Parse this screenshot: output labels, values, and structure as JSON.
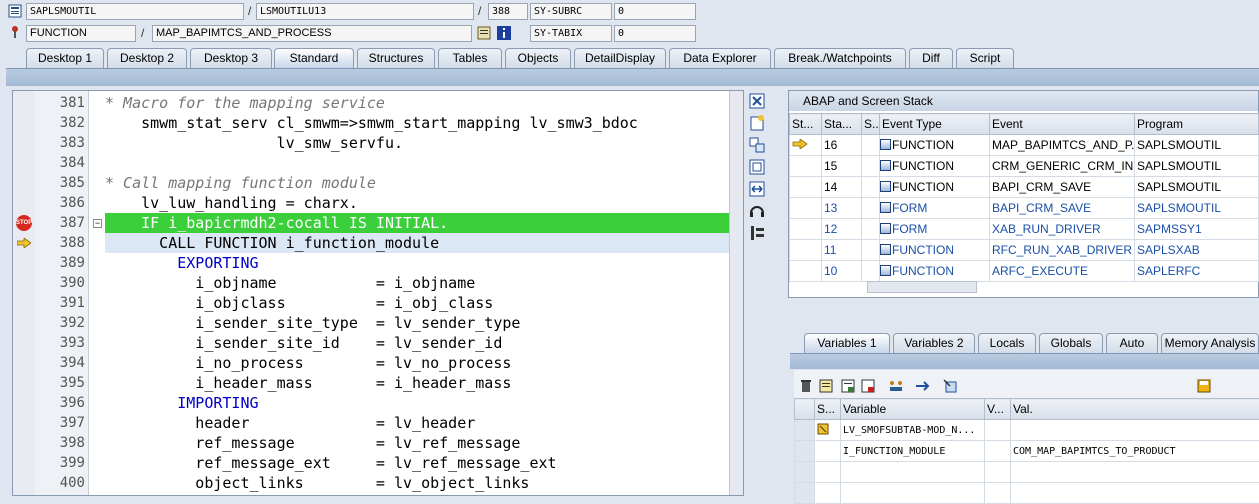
{
  "header": {
    "row1": {
      "program": "SAPLSMOUTIL",
      "include": "LSMOUTILU13",
      "line": "388",
      "sy_label": "SY-SUBRC",
      "sy_value": "0"
    },
    "row2": {
      "type": "FUNCTION",
      "name": "MAP_BAPIMTCS_AND_PROCESS",
      "sy_label": "SY-TABIX",
      "sy_value": "0"
    },
    "sep": "/"
  },
  "tabs": [
    "Desktop 1",
    "Desktop 2",
    "Desktop 3",
    "Standard",
    "Structures",
    "Tables",
    "Objects",
    "DetailDisplay",
    "Data Explorer",
    "Break./Watchpoints",
    "Diff",
    "Script"
  ],
  "active_tab": "Standard",
  "code_lines": [
    {
      "n": "381",
      "text": "* Macro for the mapping service"
    },
    {
      "n": "382",
      "text": "    smwm_stat_serv cl_smwm=>smwm_start_mapping lv_smw3_bdoc"
    },
    {
      "n": "383",
      "text": "                   lv_smw_servfu."
    },
    {
      "n": "384",
      "text": ""
    },
    {
      "n": "385",
      "text": "* Call mapping function module"
    },
    {
      "n": "386",
      "text": "    lv_luw_handling = charx."
    },
    {
      "n": "387",
      "text": "    IF i_bapicrmdh2-cocall IS INITIAL."
    },
    {
      "n": "388",
      "text": "      CALL FUNCTION i_function_module"
    },
    {
      "n": "389",
      "text": "        EXPORTING"
    },
    {
      "n": "390",
      "text": "          i_objname           = i_objname"
    },
    {
      "n": "391",
      "text": "          i_objclass          = i_obj_class"
    },
    {
      "n": "392",
      "text": "          i_sender_site_type  = lv_sender_type"
    },
    {
      "n": "393",
      "text": "          i_sender_site_id    = lv_sender_id"
    },
    {
      "n": "394",
      "text": "          i_no_process        = lv_no_process"
    },
    {
      "n": "395",
      "text": "          i_header_mass       = i_header_mass"
    },
    {
      "n": "396",
      "text": "        IMPORTING"
    },
    {
      "n": "397",
      "text": "          header              = lv_header"
    },
    {
      "n": "398",
      "text": "          ref_message         = lv_ref_message"
    },
    {
      "n": "399",
      "text": "          ref_message_ext     = lv_ref_message_ext"
    },
    {
      "n": "400",
      "text": "          object_links        = lv_object_links"
    }
  ],
  "stop_label": "STOP",
  "stack": {
    "title": "ABAP and Screen Stack",
    "headers": [
      "St...",
      "Sta...",
      "S...",
      "Event Type",
      "Event",
      "Program"
    ],
    "rows": [
      {
        "level": "16",
        "type": "FUNCTION",
        "event": "MAP_BAPIMTCS_AND_P...",
        "program": "SAPLSMOUTIL"
      },
      {
        "level": "15",
        "type": "FUNCTION",
        "event": "CRM_GENERIC_CRM_IN",
        "program": "SAPLSMOUTIL"
      },
      {
        "level": "14",
        "type": "FUNCTION",
        "event": "BAPI_CRM_SAVE",
        "program": "SAPLSMOUTIL"
      },
      {
        "level": "13",
        "type": "FORM",
        "event": "BAPI_CRM_SAVE",
        "program": "SAPLSMOUTIL"
      },
      {
        "level": "12",
        "type": "FORM",
        "event": "XAB_RUN_DRIVER",
        "program": "SAPMSSY1"
      },
      {
        "level": "11",
        "type": "FUNCTION",
        "event": "RFC_RUN_XAB_DRIVER",
        "program": "SAPLSXAB"
      },
      {
        "level": "10",
        "type": "FUNCTION",
        "event": "ARFC_EXECUTE",
        "program": "SAPLERFC"
      }
    ]
  },
  "var_tabs": [
    "Variables 1",
    "Variables 2",
    "Locals",
    "Globals",
    "Auto",
    "Memory Analysis"
  ],
  "variables": {
    "headers": [
      "S...",
      "Variable",
      "V...",
      "Val."
    ],
    "rows": [
      {
        "variable": "LV_SMOFSUBTAB-MOD_N...",
        "value": ""
      },
      {
        "variable": "I_FUNCTION_MODULE",
        "value": "COM_MAP_BAPIMTCS_TO_PRODUCT"
      }
    ]
  },
  "colors": {
    "breakpoint_highlight": "#3ccf3c",
    "current_line": "#dce7f6",
    "link_blue": "#1a4fa8"
  }
}
